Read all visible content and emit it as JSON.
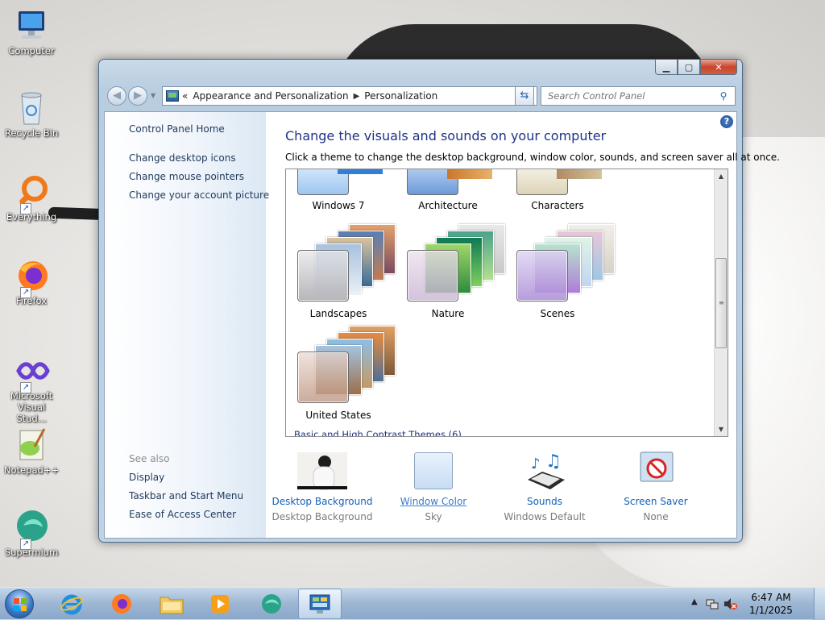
{
  "desktop": {
    "icons": [
      {
        "label": "Computer"
      },
      {
        "label": "Recycle Bin"
      },
      {
        "label": "Everything"
      },
      {
        "label": "Firefox"
      },
      {
        "label": "Microsoft Visual Stud..."
      },
      {
        "label": "Notepad++"
      },
      {
        "label": "Supermium"
      }
    ]
  },
  "window": {
    "address": {
      "overflow": "«",
      "crumbs": [
        "Appearance and Personalization",
        "Personalization"
      ]
    },
    "search": {
      "placeholder": "Search Control Panel"
    },
    "sidebar": {
      "links": [
        "Control Panel Home",
        "Change desktop icons",
        "Change mouse pointers",
        "Change your account picture"
      ],
      "see_also_heading": "See also",
      "see_also": [
        "Display",
        "Taskbar and Start Menu",
        "Ease of Access Center"
      ]
    },
    "main": {
      "heading": "Change the visuals and sounds on your computer",
      "subtitle": "Click a theme to change the desktop background, window color, sounds, and screen saver all at once.",
      "themes_partial": [
        "Windows 7",
        "Architecture",
        "Characters"
      ],
      "themes": [
        "Landscapes",
        "Nature",
        "Scenes",
        "United States"
      ],
      "group_heading": "Basic and High Contrast Themes (6)"
    },
    "bottom": [
      {
        "link": "Desktop Background",
        "value": "Desktop Background"
      },
      {
        "link": "Window Color",
        "value": "Sky"
      },
      {
        "link": "Sounds",
        "value": "Windows Default"
      },
      {
        "link": "Screen Saver",
        "value": "None"
      }
    ]
  },
  "taskbar": {
    "clock_time": "6:47 AM",
    "clock_date": "1/1/2025"
  },
  "colors": {
    "accent_link": "#1560b8",
    "heading": "#1e3287",
    "close_button": "#c8452c"
  }
}
